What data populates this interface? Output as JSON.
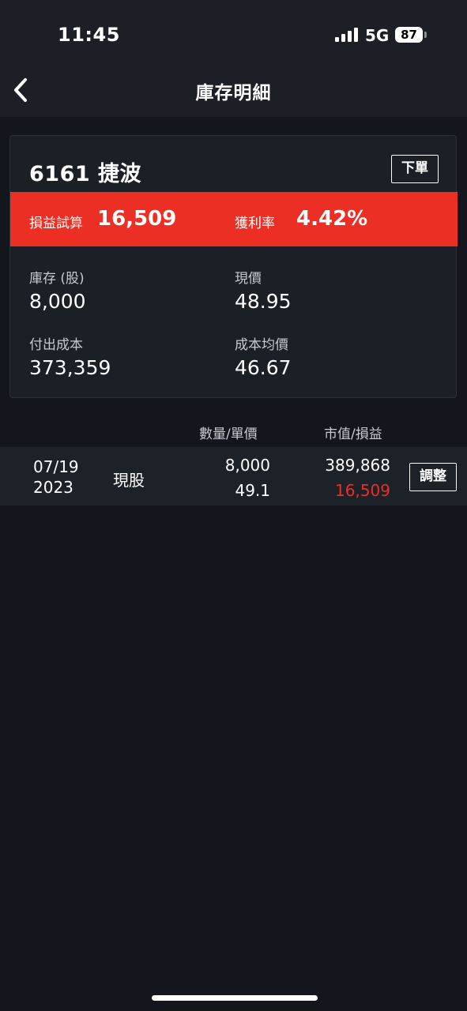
{
  "status_bar": {
    "time": "11:45",
    "network": "5G",
    "battery": "87"
  },
  "nav": {
    "title": "庫存明細"
  },
  "stock": {
    "title": "6161 捷波",
    "order_button": "下單",
    "profit_label": "損益試算",
    "profit_value": "16,509",
    "rate_label": "獲利率",
    "rate_value": "4.42%",
    "inventory_label": "庫存 (股)",
    "inventory_value": "8,000",
    "price_label": "現價",
    "price_value": "48.95",
    "cost_label": "付出成本",
    "cost_value": "373,359",
    "avg_cost_label": "成本均價",
    "avg_cost_value": "46.67"
  },
  "table": {
    "col_qty_price": "數量/單價",
    "col_value_pl": "市值/損益",
    "rows": [
      {
        "date": "07/19",
        "year": "2023",
        "type": "現股",
        "quantity": "8,000",
        "unit_price": "49.1",
        "market_value": "389,868",
        "profit": "16,509",
        "action": "調整"
      }
    ]
  },
  "colors": {
    "background": "#13161c",
    "profit_red": "#eb2f24",
    "card": "#1b1f26"
  }
}
